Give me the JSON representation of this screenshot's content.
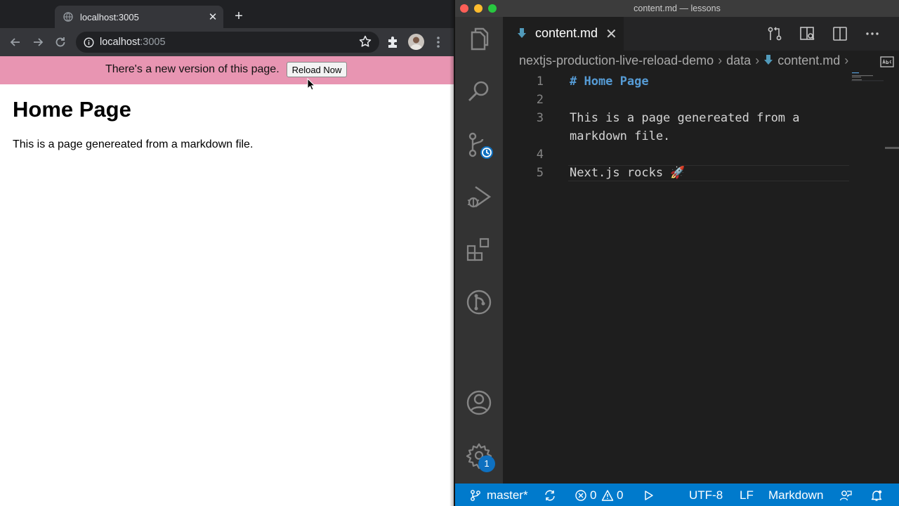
{
  "browser": {
    "tab_title": "localhost:3005",
    "url_host": "localhost",
    "url_port": ":3005",
    "notice": {
      "text": "There's a new version of this page.",
      "button_label": "Reload Now"
    },
    "page": {
      "heading": "Home Page",
      "paragraph": "This is a page genereated from a markdown file."
    },
    "colors": {
      "notice_bg": "#e895b2"
    }
  },
  "editor": {
    "window_title": "content.md — lessons",
    "tab_label": "content.md",
    "breadcrumb": [
      "nextjs-production-live-reload-demo",
      "data",
      "content.md"
    ],
    "line_numbers": [
      "1",
      "2",
      "3",
      "4",
      "5"
    ],
    "code_lines": [
      "# Home Page",
      "",
      "This is a page genereated from a",
      "markdown file.",
      "",
      "Next.js rocks 🚀"
    ],
    "settings_badge": "1",
    "status": {
      "branch": "master*",
      "errors": "0",
      "warnings": "0",
      "encoding": "UTF-8",
      "eol": "LF",
      "language": "Markdown"
    },
    "colors": {
      "statusbar": "#007acc",
      "heading": "#569cd6"
    },
    "activity_icons": [
      "files-icon",
      "search-icon",
      "source-control-icon",
      "run-debug-icon",
      "extensions-icon",
      "git-graph-icon",
      "account-icon",
      "settings-gear-icon"
    ]
  }
}
